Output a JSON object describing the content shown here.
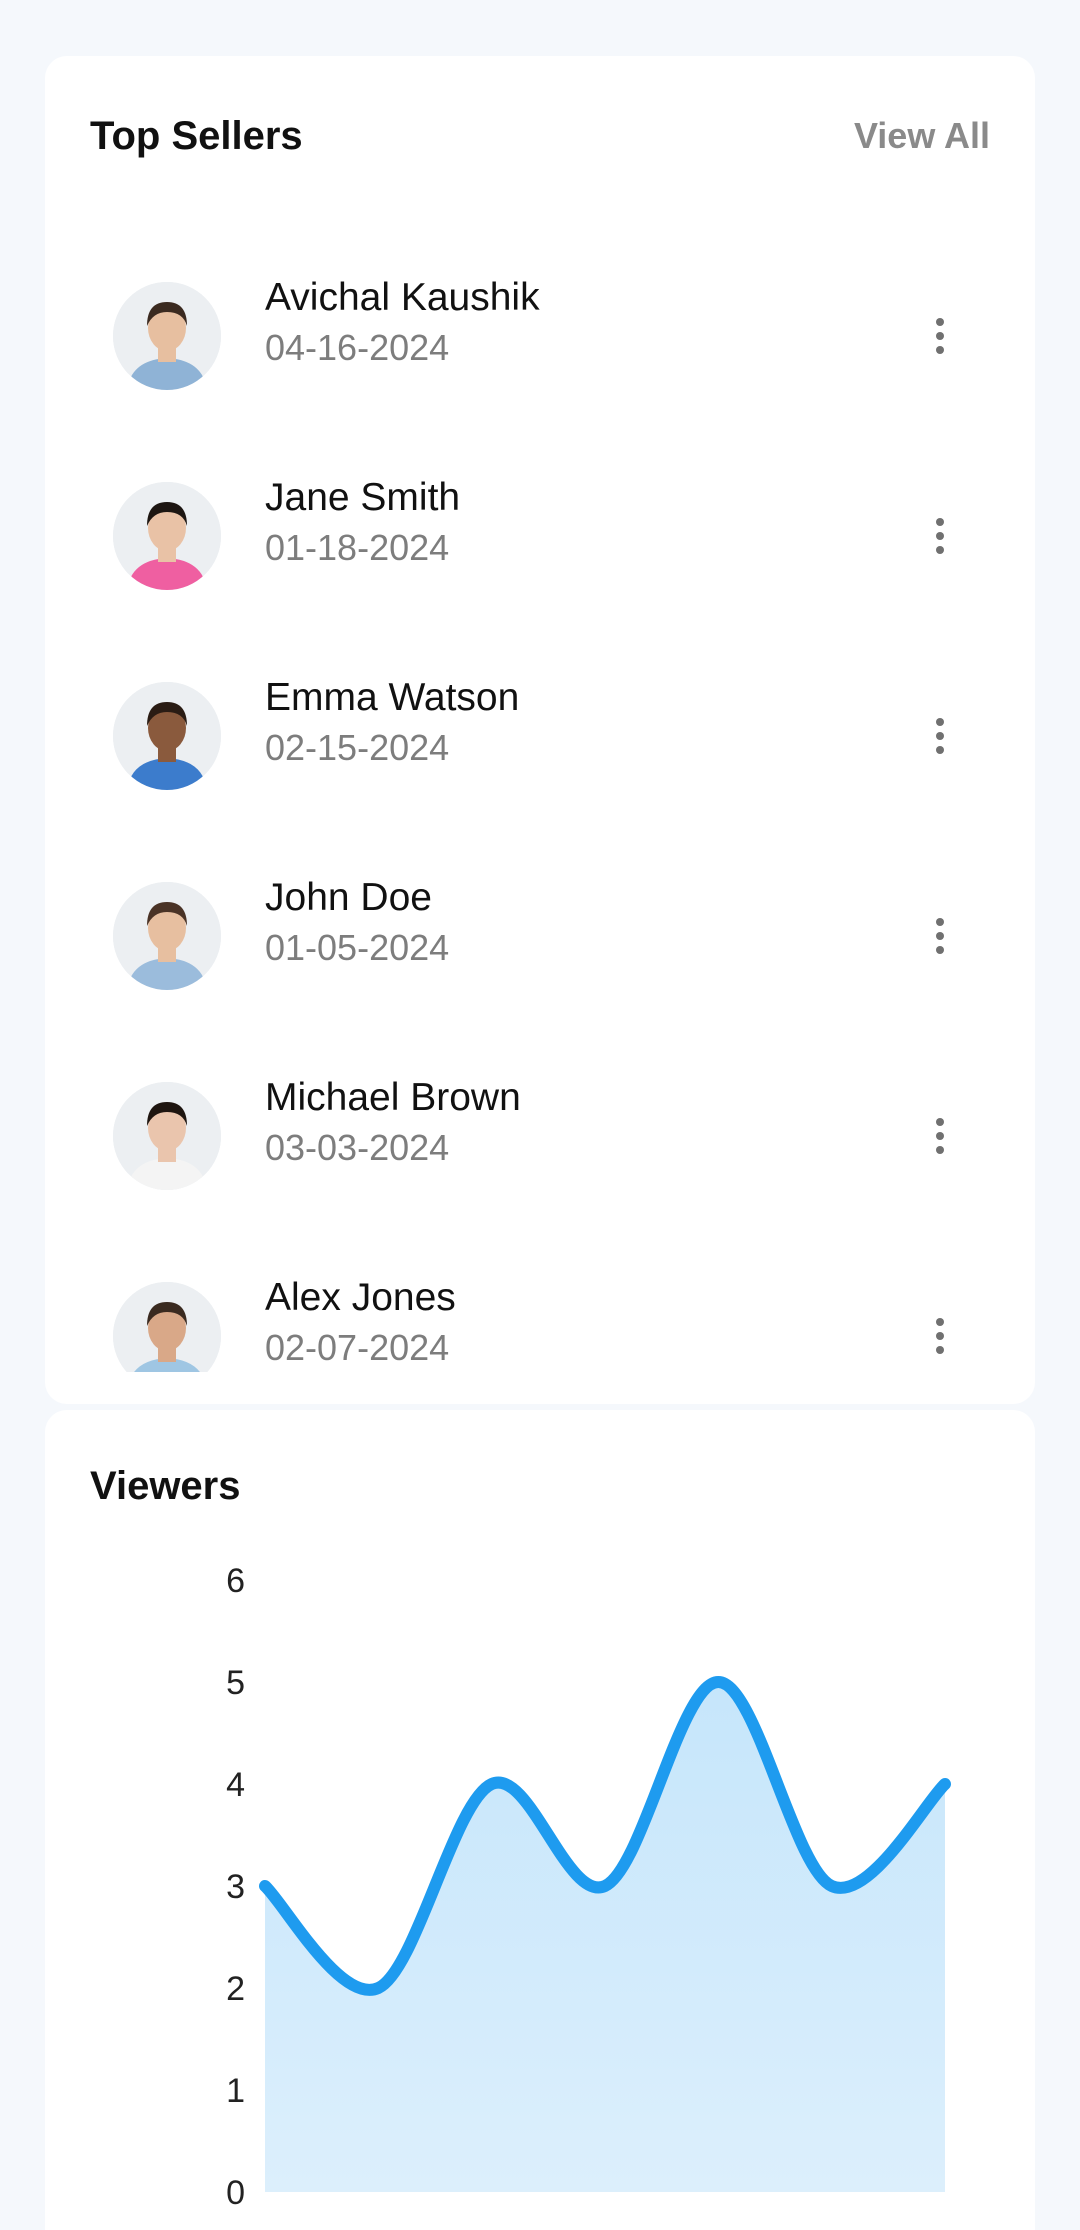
{
  "top_sellers": {
    "title": "Top Sellers",
    "view_all_label": "View All",
    "items": [
      {
        "name": "Avichal Kaushik",
        "date": "04-16-2024",
        "avatar": {
          "skin": "#e7bfa0",
          "hair": "#3b2a20",
          "shirt": "#8fb3d6"
        }
      },
      {
        "name": "Jane Smith",
        "date": "01-18-2024",
        "avatar": {
          "skin": "#e9c2a6",
          "hair": "#1d1612",
          "shirt": "#ef5fa1"
        }
      },
      {
        "name": "Emma Watson",
        "date": "02-15-2024",
        "avatar": {
          "skin": "#8a5a3d",
          "hair": "#2a1c14",
          "shirt": "#3c7ccc"
        }
      },
      {
        "name": "John Doe",
        "date": "01-05-2024",
        "avatar": {
          "skin": "#e7bfa0",
          "hair": "#4a3326",
          "shirt": "#9bbcdc"
        }
      },
      {
        "name": "Michael Brown",
        "date": "03-03-2024",
        "avatar": {
          "skin": "#eac5ad",
          "hair": "#1e1510",
          "shirt": "#f4f4f4"
        }
      },
      {
        "name": "Alex Jones",
        "date": "02-07-2024",
        "avatar": {
          "skin": "#d9a888",
          "hair": "#3a2a20",
          "shirt": "#9fc6e3"
        }
      }
    ]
  },
  "viewers": {
    "title": "Viewers"
  },
  "chart_data": {
    "type": "area",
    "x": [
      0,
      1,
      2,
      3,
      4,
      5,
      6
    ],
    "values": [
      3,
      2,
      4,
      3,
      5,
      3,
      4
    ],
    "yticks": [
      "0",
      "1",
      "2",
      "3",
      "4",
      "5",
      "6"
    ],
    "ylim": [
      0,
      6
    ],
    "grid": false,
    "line_color": "#1e9bef",
    "fill_color": "#c6e6fb"
  }
}
